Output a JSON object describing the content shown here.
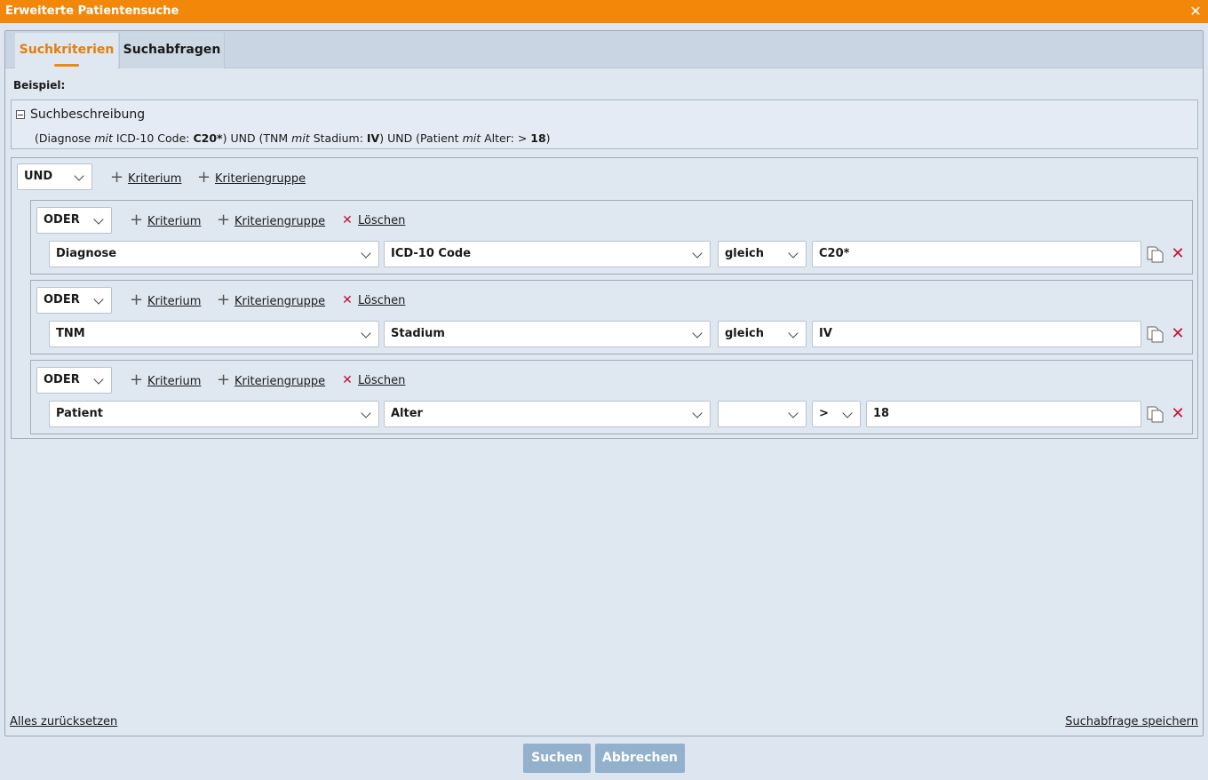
{
  "window": {
    "title": "Erweiterte Patientensuche",
    "close": "✕"
  },
  "tabs": [
    {
      "label": "Suchkriterien",
      "active": true
    },
    {
      "label": "Suchabfragen",
      "active": false
    }
  ],
  "example_label": "Beispiel:",
  "description": {
    "title": "Suchbeschreibung",
    "parts": {
      "p1": "(Diagnose ",
      "mit1": "mit",
      "p2": " ICD-10 Code: ",
      "v1": "C20*",
      "p3": ") UND (TNM ",
      "mit2": "mit",
      "p4": " Stadium: ",
      "v2": "IV",
      "p5": ") UND (Patient ",
      "mit3": "mit",
      "p6": " Alter: > ",
      "v3": "18",
      "p7": ")"
    }
  },
  "root": {
    "operator": "UND",
    "add_criterion": "Kriterium",
    "add_group": "Kriteriengruppe"
  },
  "groups": [
    {
      "operator": "ODER",
      "add_criterion": "Kriterium",
      "add_group": "Kriteriengruppe",
      "delete": "Löschen",
      "row": {
        "entity": "Diagnose",
        "attribute": "ICD-10 Code",
        "comparator": "gleich",
        "value": "C20*"
      }
    },
    {
      "operator": "ODER",
      "add_criterion": "Kriterium",
      "add_group": "Kriteriengruppe",
      "delete": "Löschen",
      "row": {
        "entity": "TNM",
        "attribute": "Stadium",
        "comparator": "gleich",
        "value": "IV"
      }
    },
    {
      "operator": "ODER",
      "add_criterion": "Kriterium",
      "add_group": "Kriteriengruppe",
      "delete": "Löschen",
      "row": {
        "entity": "Patient",
        "attribute": "Alter",
        "comparator": "",
        "operator2": ">",
        "value": "18"
      }
    }
  ],
  "footer": {
    "reset": "Alles zurücksetzen",
    "save_query": "Suchabfrage speichern"
  },
  "buttons": {
    "search": "Suchen",
    "cancel": "Abbrechen"
  },
  "colors": {
    "accent": "#f2870a",
    "delete": "#c8102e",
    "button": "#93b0cc"
  }
}
